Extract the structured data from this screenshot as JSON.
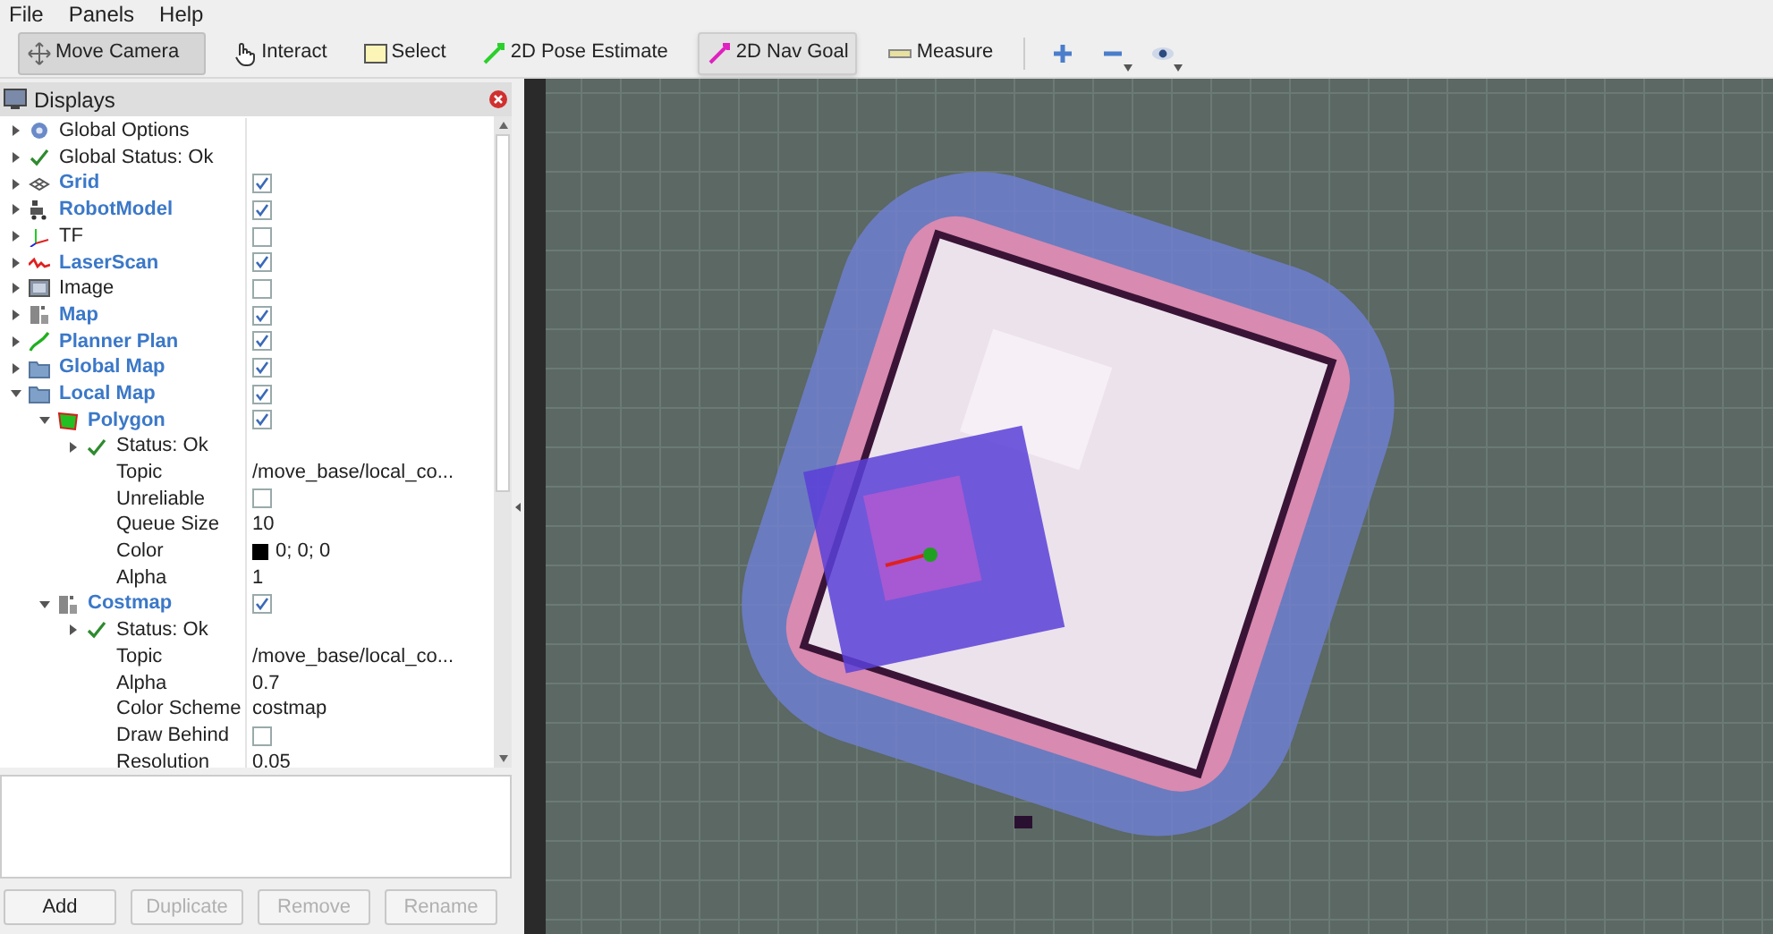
{
  "menu": [
    "File",
    "Panels",
    "Help"
  ],
  "tools": [
    {
      "label": "Move Camera",
      "kind": "camera",
      "selected": true,
      "hovered": false
    },
    {
      "label": "Interact",
      "kind": "hand",
      "selected": false,
      "hovered": false
    },
    {
      "label": "Select",
      "kind": "select",
      "selected": false,
      "hovered": false
    },
    {
      "label": "2D Pose Estimate",
      "kind": "pose",
      "selected": false,
      "hovered": false
    },
    {
      "label": "2D Nav Goal",
      "kind": "goal",
      "selected": false,
      "hovered": true
    },
    {
      "label": "Measure",
      "kind": "ruler",
      "selected": false,
      "hovered": false
    }
  ],
  "view_tools": [
    {
      "kind": "plus",
      "dropdown": false
    },
    {
      "kind": "minus",
      "dropdown": true
    },
    {
      "kind": "eye",
      "dropdown": true
    }
  ],
  "displays": {
    "title": "Displays",
    "items": [
      {
        "label": "Global Options",
        "kind": "gear",
        "expanded": false
      },
      {
        "label": "Global Status: Ok",
        "kind": "check",
        "expanded": false
      },
      {
        "label": "Grid",
        "kind": "grid",
        "expanded": false,
        "checked": true
      },
      {
        "label": "RobotModel",
        "kind": "robot",
        "expanded": false,
        "checked": true
      },
      {
        "label": "TF",
        "kind": "tf",
        "expanded": false,
        "checked": false
      },
      {
        "label": "LaserScan",
        "kind": "laser",
        "expanded": false,
        "checked": true
      },
      {
        "label": "Image",
        "kind": "image",
        "expanded": false,
        "checked": false
      },
      {
        "label": "Map",
        "kind": "map",
        "expanded": false,
        "checked": true
      },
      {
        "label": "Planner Plan",
        "kind": "plan",
        "expanded": false,
        "checked": true
      },
      {
        "label": "Global Map",
        "kind": "folder",
        "expanded": false,
        "checked": true
      },
      {
        "label": "Local Map",
        "kind": "folder",
        "expanded": true,
        "checked": true,
        "children": [
          {
            "label": "Polygon",
            "kind": "polygon",
            "expanded": true,
            "checked": true,
            "children": [
              {
                "label": "Status: Ok",
                "kind": "check",
                "expanded": false
              },
              {
                "label": "Topic",
                "value": "/move_base/local_co..."
              },
              {
                "label": "Unreliable",
                "checked": false
              },
              {
                "label": "Queue Size",
                "value": "10"
              },
              {
                "label": "Color",
                "value": "0; 0; 0",
                "color": "#000000"
              },
              {
                "label": "Alpha",
                "value": "1"
              }
            ]
          },
          {
            "label": "Costmap",
            "kind": "map",
            "expanded": true,
            "checked": true,
            "children": [
              {
                "label": "Status: Ok",
                "kind": "check",
                "expanded": false
              },
              {
                "label": "Topic",
                "value": "/move_base/local_co..."
              },
              {
                "label": "Alpha",
                "value": "0.7"
              },
              {
                "label": "Color Scheme",
                "value": "costmap"
              },
              {
                "label": "Draw Behind",
                "checked": false
              },
              {
                "label": "Resolution",
                "value": "0.05"
              }
            ]
          }
        ]
      }
    ]
  },
  "buttons": [
    {
      "label": "Add",
      "disabled": false
    },
    {
      "label": "Duplicate",
      "disabled": true
    },
    {
      "label": "Remove",
      "disabled": true
    },
    {
      "label": "Rename",
      "disabled": true
    }
  ]
}
